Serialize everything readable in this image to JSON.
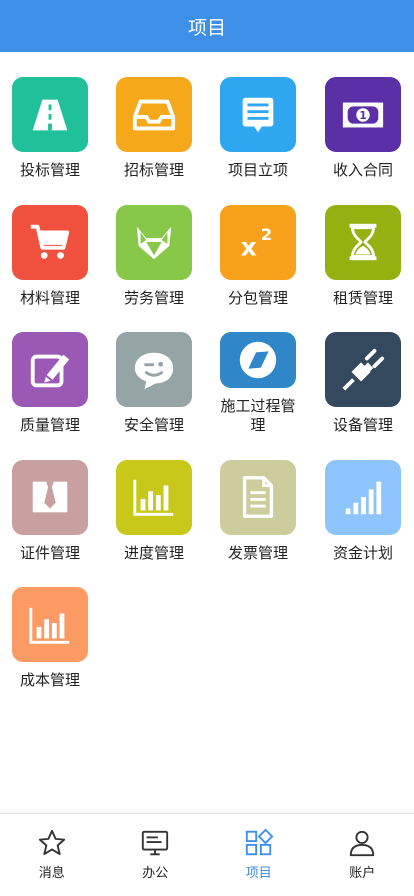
{
  "header": {
    "title": "项目"
  },
  "modules": [
    {
      "label": "投标管理",
      "color": "#1fc09a",
      "icon": "road-icon"
    },
    {
      "label": "招标管理",
      "color": "#f6a81b",
      "icon": "inbox-icon"
    },
    {
      "label": "项目立项",
      "color": "#2ea7f0",
      "icon": "message-list-icon"
    },
    {
      "label": "收入合同",
      "color": "#5b2fa5",
      "icon": "money-bill-icon"
    },
    {
      "label": "材料管理",
      "color": "#f0513e",
      "icon": "cart-icon"
    },
    {
      "label": "劳务管理",
      "color": "#88c849",
      "icon": "fox-icon"
    },
    {
      "label": "分包管理",
      "color": "#f8a21b",
      "icon": "superscript-icon"
    },
    {
      "label": "租赁管理",
      "color": "#94b111",
      "icon": "hourglass-icon"
    },
    {
      "label": "质量管理",
      "color": "#9b59b6",
      "icon": "edit-icon"
    },
    {
      "label": "安全管理",
      "color": "#95a5a6",
      "icon": "chat-face-icon"
    },
    {
      "label": "施工过程管理",
      "color": "#2f86c9",
      "icon": "compass-icon"
    },
    {
      "label": "设备管理",
      "color": "#34495e",
      "icon": "plug-icon"
    },
    {
      "label": "证件管理",
      "color": "#c9a0a0",
      "icon": "tie-icon"
    },
    {
      "label": "进度管理",
      "color": "#c8c81a",
      "icon": "bar-chart-icon"
    },
    {
      "label": "发票管理",
      "color": "#cdcc9c",
      "icon": "document-icon"
    },
    {
      "label": "资金计划",
      "color": "#8cc4fb",
      "icon": "signal-bars-icon"
    },
    {
      "label": "成本管理",
      "color": "#fb9a62",
      "icon": "bar-chart-icon"
    }
  ],
  "tabs": [
    {
      "label": "消息",
      "icon": "star-icon",
      "active": false
    },
    {
      "label": "办公",
      "icon": "monitor-icon",
      "active": false
    },
    {
      "label": "项目",
      "icon": "grid-diamond-icon",
      "active": true
    },
    {
      "label": "账户",
      "icon": "user-icon",
      "active": false
    }
  ],
  "colors": {
    "header": "#3d8fe8",
    "active_tab": "#3d8fe8"
  }
}
